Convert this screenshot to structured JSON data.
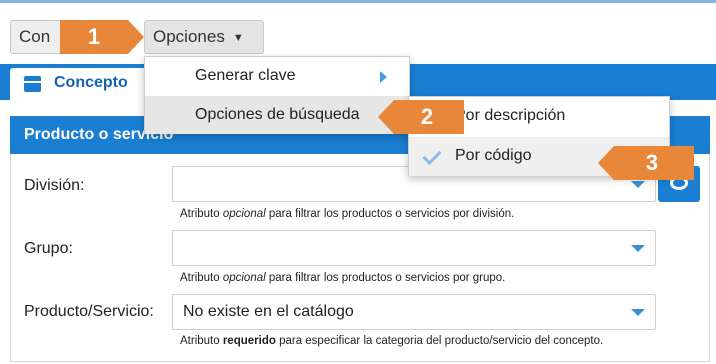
{
  "toolbar": {
    "con_label": "Con",
    "opciones_label": "Opciones",
    "caret": "▼"
  },
  "tab": {
    "label": "Concepto"
  },
  "panel": {
    "header": "Producto o servicio"
  },
  "menu": {
    "items": [
      {
        "label": "Generar clave"
      },
      {
        "label": "Opciones de búsqueda"
      }
    ]
  },
  "submenu": {
    "items": [
      {
        "label": "Por descripción"
      },
      {
        "label": "Por código",
        "checked": true
      }
    ]
  },
  "fields": {
    "division": {
      "label": "División:",
      "value": "",
      "hint_pre": "Atributo ",
      "hint_em": "opcional",
      "hint_post": " para filtrar los productos o servicios por división."
    },
    "grupo": {
      "label": "Grupo:",
      "value": "",
      "hint_pre": "Atributo ",
      "hint_em": "opcional",
      "hint_post": " para filtrar los productos o servicios por grupo."
    },
    "producto": {
      "label": "Producto/Servicio:",
      "value": "No existe en el catálogo",
      "hint_pre": "Atributo ",
      "hint_strong": "requerido",
      "hint_post": " para especificar la categoria del producto/servicio del concepto."
    }
  },
  "callouts": [
    "1",
    "2",
    "3"
  ],
  "colors": {
    "accent": "#1a7fd3",
    "callout": "#e8873a"
  }
}
